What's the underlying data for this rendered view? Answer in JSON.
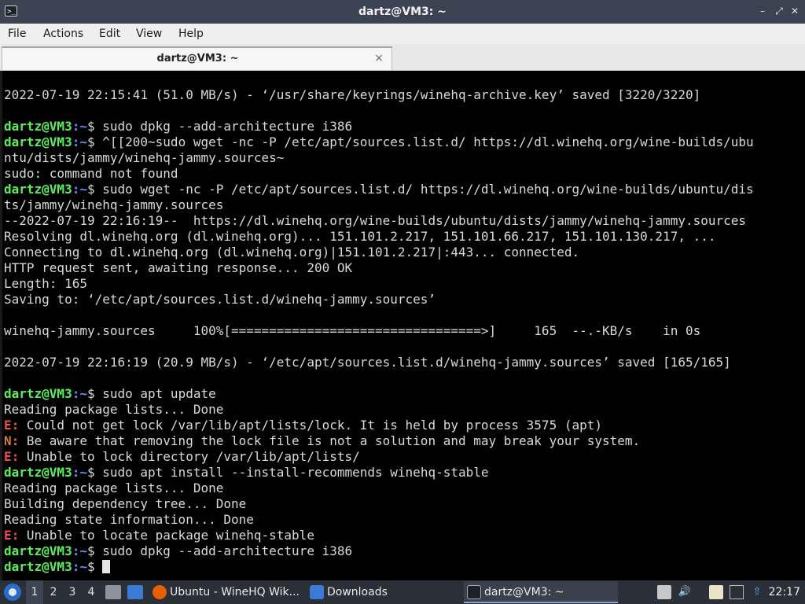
{
  "window": {
    "title": "dartz@VM3: ~",
    "app_icon_glyph": ">_",
    "controls": {
      "minimize": "–",
      "restore": "⤢",
      "close": "✕"
    }
  },
  "menu": {
    "items": [
      "File",
      "Actions",
      "Edit",
      "View",
      "Help"
    ]
  },
  "tabs": [
    {
      "label": "dartz@VM3: ~",
      "close": "×"
    }
  ],
  "terminal": {
    "colors": {
      "prompt_user": "#5af05a",
      "prompt_path": "#6b8cff",
      "error": "#f04f4f",
      "note": "#d07a3a",
      "text": "#d9d9d9"
    },
    "lines": [
      {
        "text": "2022-07-19 22:15:41 (51.0 MB/s) - ‘/usr/share/keyrings/winehq-archive.key’ saved [3220/3220]"
      },
      {
        "text": ""
      },
      {
        "prompt": "dartz@VM3",
        "path": ":~",
        "text": "$ sudo dpkg --add-architecture i386"
      },
      {
        "prompt": "dartz@VM3",
        "path": ":~",
        "text": "$ ^[[200~sudo wget -nc -P /etc/apt/sources.list.d/ https://dl.winehq.org/wine-builds/ubu"
      },
      {
        "text": "ntu/dists/jammy/winehq-jammy.sources~"
      },
      {
        "text": "sudo: command not found"
      },
      {
        "prompt": "dartz@VM3",
        "path": ":~",
        "text": "$ sudo wget -nc -P /etc/apt/sources.list.d/ https://dl.winehq.org/wine-builds/ubuntu/dis"
      },
      {
        "text": "ts/jammy/winehq-jammy.sources"
      },
      {
        "text": "--2022-07-19 22:16:19--  https://dl.winehq.org/wine-builds/ubuntu/dists/jammy/winehq-jammy.sources"
      },
      {
        "text": "Resolving dl.winehq.org (dl.winehq.org)... 151.101.2.217, 151.101.66.217, 151.101.130.217, ..."
      },
      {
        "text": "Connecting to dl.winehq.org (dl.winehq.org)|151.101.2.217|:443... connected."
      },
      {
        "text": "HTTP request sent, awaiting response... 200 OK"
      },
      {
        "text": "Length: 165"
      },
      {
        "text": "Saving to: ‘/etc/apt/sources.list.d/winehq-jammy.sources’"
      },
      {
        "text": ""
      },
      {
        "text": "winehq-jammy.sources     100%[=================================>]     165  --.-KB/s    in 0s"
      },
      {
        "text": ""
      },
      {
        "text": "2022-07-19 22:16:19 (20.9 MB/s) - ‘/etc/apt/sources.list.d/winehq-jammy.sources’ saved [165/165]"
      },
      {
        "text": ""
      },
      {
        "prompt": "dartz@VM3",
        "path": ":~",
        "text": "$ sudo apt update"
      },
      {
        "text": "Reading package lists... Done"
      },
      {
        "tag": "E:",
        "tagtype": "err",
        "text": " Could not get lock /var/lib/apt/lists/lock. It is held by process 3575 (apt)"
      },
      {
        "tag": "N:",
        "tagtype": "note",
        "text": " Be aware that removing the lock file is not a solution and may break your system."
      },
      {
        "tag": "E:",
        "tagtype": "err",
        "text": " Unable to lock directory /var/lib/apt/lists/"
      },
      {
        "prompt": "dartz@VM3",
        "path": ":~",
        "text": "$ sudo apt install --install-recommends winehq-stable"
      },
      {
        "text": "Reading package lists... Done"
      },
      {
        "text": "Building dependency tree... Done"
      },
      {
        "text": "Reading state information... Done"
      },
      {
        "tag": "E:",
        "tagtype": "err",
        "text": " Unable to locate package winehq-stable"
      },
      {
        "prompt": "dartz@VM3",
        "path": ":~",
        "text": "$ sudo dpkg --add-architecture i386"
      },
      {
        "prompt": "dartz@VM3",
        "path": ":~",
        "text": "$ ",
        "cursor": true
      }
    ]
  },
  "taskbar": {
    "workspaces": [
      "1",
      "2",
      "3",
      "4"
    ],
    "active_workspace": "1",
    "tasks": [
      {
        "label": "Ubuntu - WineHQ Wik...",
        "icon": "firefox-icon",
        "color": "#e66000"
      },
      {
        "label": "Downloads",
        "icon": "folder-icon",
        "color": "#3a7bd5"
      },
      {
        "label": "dartz@VM3: ~",
        "icon": "terminal-icon",
        "color": "#1d2128"
      }
    ],
    "tray": {
      "volume_glyph": "🔊",
      "update_glyph": "⇧"
    },
    "clock": "22:17"
  }
}
